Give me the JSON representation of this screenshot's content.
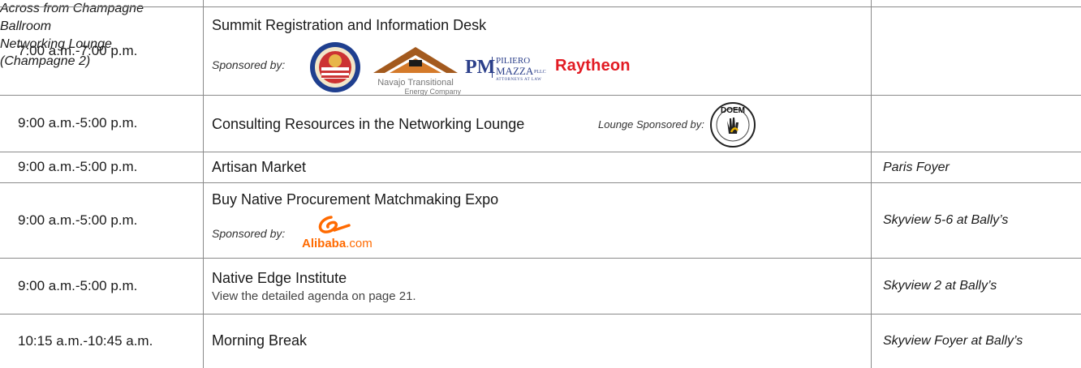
{
  "rows": [
    {
      "time": "7:00 a.m.-7:00 p.m.",
      "title": "Summit Registration and Information Desk",
      "sponsor_label": "Sponsored by:",
      "location": "Across from Champagne Ballroom",
      "logos": {
        "navajo_line1": "Navajo Transitional",
        "navajo_line2": "Energy Company",
        "pm_mark": "PM",
        "pm_name1": "PILIERO",
        "pm_name2": "MAZZA",
        "pm_suffix": "PLLC",
        "pm_sub": "ATTORNEYS AT LAW",
        "raytheon": "Raytheon"
      }
    },
    {
      "time": "9:00 a.m.-5:00 p.m.",
      "title": "Consulting Resources in the Networking Lounge",
      "sponsor_label": "Lounge Sponsored by:",
      "location_line1": "Networking Lounge",
      "location_line2": "(Champagne 2)",
      "logos": {
        "doem": "DOEM"
      }
    },
    {
      "time": "9:00 a.m.-5:00 p.m.",
      "title": "Artisan Market",
      "location": "Paris Foyer"
    },
    {
      "time": "9:00 a.m.-5:00 p.m.",
      "title": "Buy Native Procurement Matchmaking Expo",
      "sponsor_label": "Sponsored by:",
      "location": "Skyview 5-6 at Bally’s",
      "logos": {
        "alibaba_word": "Alibaba",
        "alibaba_com": ".com"
      }
    },
    {
      "time": "9:00 a.m.-5:00 p.m.",
      "title": "Native Edge Institute",
      "note": "View the detailed agenda on page 21.",
      "location": "Skyview 2 at Bally’s"
    },
    {
      "time": "10:15 a.m.-10:45 a.m.",
      "title": "Morning Break",
      "location": "Skyview Foyer at Bally’s"
    }
  ]
}
